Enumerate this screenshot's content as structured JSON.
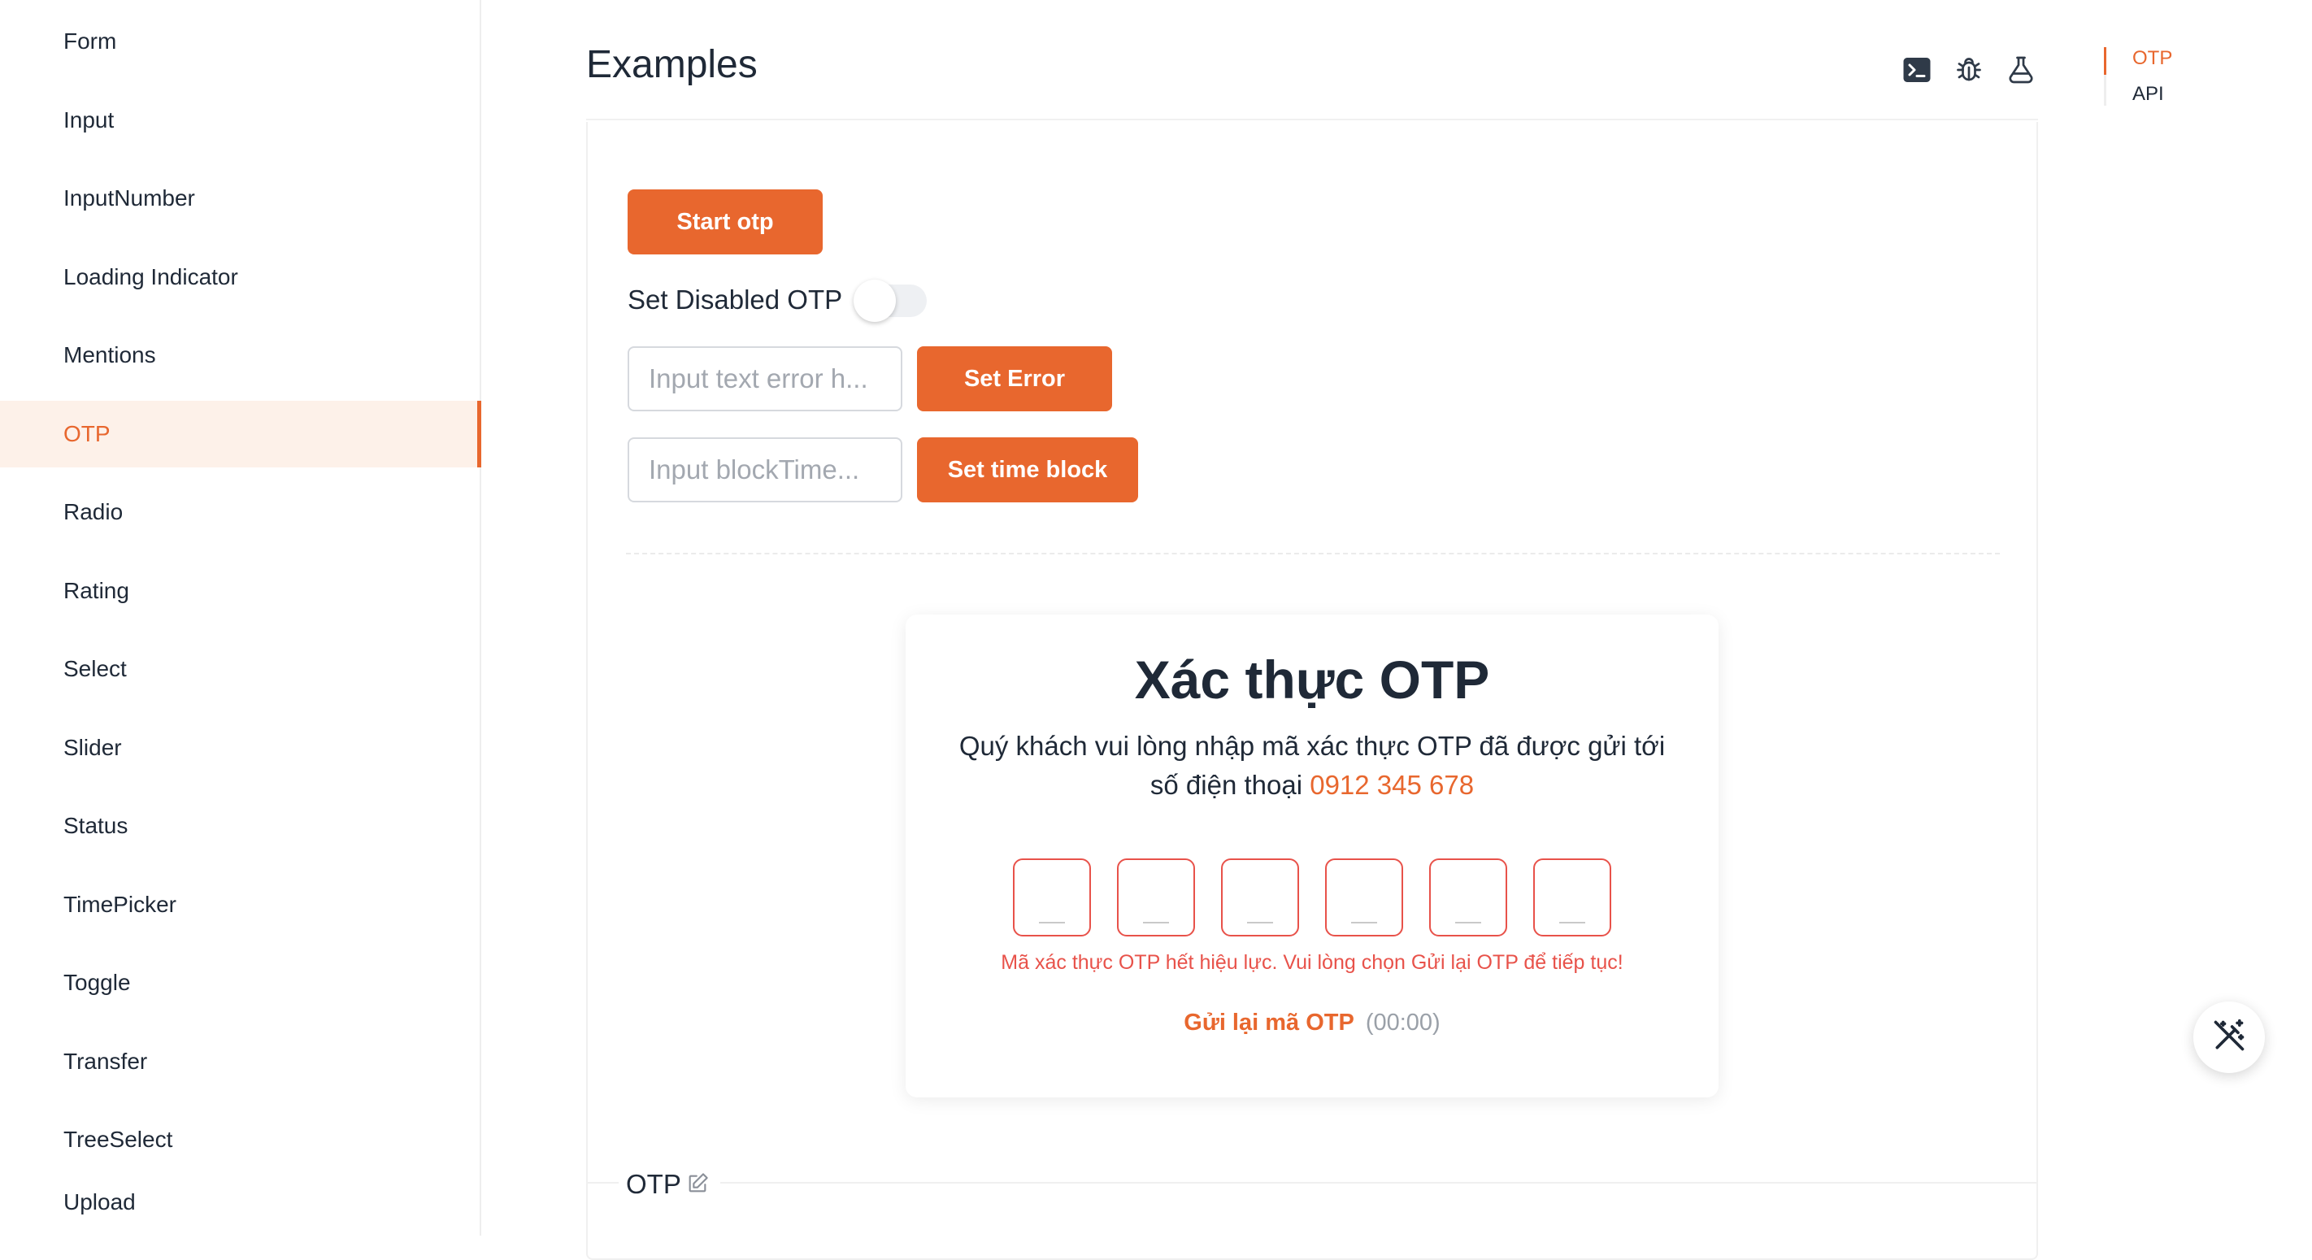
{
  "sidebar": {
    "items": [
      {
        "label": "Form"
      },
      {
        "label": "Input"
      },
      {
        "label": "InputNumber"
      },
      {
        "label": "Loading Indicator"
      },
      {
        "label": "Mentions"
      },
      {
        "label": "OTP",
        "active": true
      },
      {
        "label": "Radio"
      },
      {
        "label": "Rating"
      },
      {
        "label": "Select"
      },
      {
        "label": "Slider"
      },
      {
        "label": "Status"
      },
      {
        "label": "TimePicker"
      },
      {
        "label": "Toggle"
      },
      {
        "label": "Transfer"
      },
      {
        "label": "TreeSelect"
      },
      {
        "label": "Upload"
      }
    ]
  },
  "header": {
    "title": "Examples",
    "icons": [
      "terminal-icon",
      "bug-icon",
      "flask-icon"
    ]
  },
  "toc": {
    "items": [
      {
        "label": "OTP",
        "active": true
      },
      {
        "label": "API"
      }
    ]
  },
  "controls": {
    "start_button": "Start otp",
    "disabled_label": "Set Disabled OTP",
    "disabled_toggle_on": false,
    "error_input_placeholder": "Input text error h...",
    "set_error_button": "Set Error",
    "block_input_placeholder": "Input blockTime...",
    "set_block_button": "Set time block"
  },
  "otp": {
    "title": "Xác thực OTP",
    "description": "Quý khách vui lòng nhập mã xác thực OTP đã được gửi tới số điện thoại",
    "phone": "0912 345 678",
    "digit_count": 6,
    "error_message": "Mã xác thực OTP hết hiệu lực. Vui lòng chọn Gửi lại OTP để tiếp tục!",
    "resend_label": "Gửi lại mã OTP",
    "countdown": "(00:00)"
  },
  "section": {
    "title": "OTP",
    "icon": "edit-icon"
  },
  "colors": {
    "accent": "#e8672e",
    "error": "#e8524a",
    "active_bg": "#fdf1e9"
  }
}
